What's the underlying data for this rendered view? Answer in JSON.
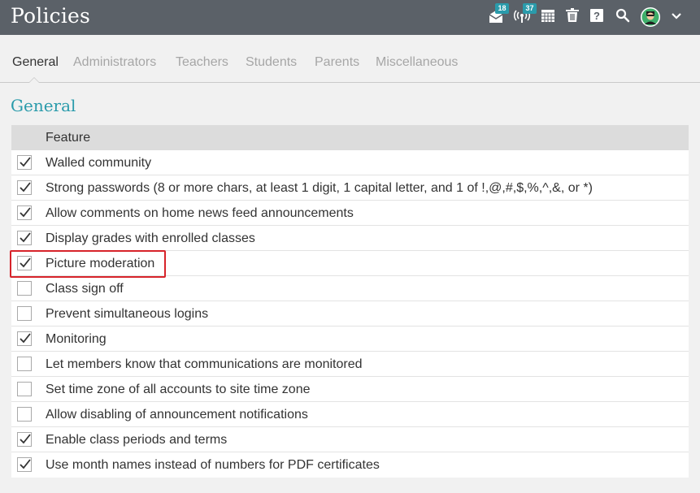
{
  "header": {
    "title": "Policies",
    "icons": [
      {
        "name": "mail-icon",
        "badge": "18"
      },
      {
        "name": "broadcast-icon",
        "badge": "37"
      },
      {
        "name": "calendar-icon"
      },
      {
        "name": "trash-icon"
      },
      {
        "name": "help-icon"
      },
      {
        "name": "search-icon"
      },
      {
        "name": "avatar"
      },
      {
        "name": "chevron-down-icon"
      }
    ],
    "badges": {
      "mail": "18",
      "broadcast": "37"
    },
    "help_glyph": "?"
  },
  "tabs": [
    "General",
    "Administrators",
    "Teachers",
    "Students",
    "Parents",
    "Miscellaneous"
  ],
  "active_tab": "General",
  "section_title": "General",
  "table": {
    "header": "Feature",
    "rows": [
      {
        "label": "Walled community",
        "checked": true
      },
      {
        "label": "Strong passwords (8 or more chars, at least 1 digit, 1 capital letter, and 1 of !,@,#,$,%,^,&, or *)",
        "checked": true
      },
      {
        "label": "Allow comments on home news feed announcements",
        "checked": true
      },
      {
        "label": "Display grades with enrolled classes",
        "checked": true
      },
      {
        "label": "Picture moderation",
        "checked": true,
        "highlighted": true
      },
      {
        "label": "Class sign off",
        "checked": false
      },
      {
        "label": "Prevent simultaneous logins",
        "checked": false
      },
      {
        "label": "Monitoring",
        "checked": true
      },
      {
        "label": "Let members know that communications are monitored",
        "checked": false
      },
      {
        "label": "Set time zone of all accounts to site time zone",
        "checked": false
      },
      {
        "label": "Allow disabling of announcement notifications",
        "checked": false
      },
      {
        "label": "Enable class periods and terms",
        "checked": true
      },
      {
        "label": "Use month names instead of numbers for PDF certificates",
        "checked": true
      }
    ]
  },
  "colors": {
    "topbar": "#5b6168",
    "accent": "#2a9bab",
    "highlight": "#d7232a"
  }
}
